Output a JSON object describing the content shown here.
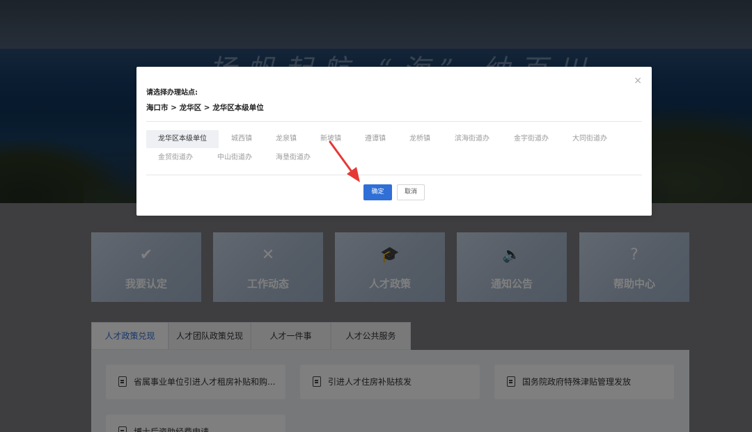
{
  "banner": {
    "slogan": "扬帆起航 “海” 纳百川"
  },
  "tiles": [
    {
      "label": "我要认定",
      "icon": "shield-check-icon",
      "glyph": "✔"
    },
    {
      "label": "工作动态",
      "icon": "pinwheel-icon",
      "glyph": "✕"
    },
    {
      "label": "人才政策",
      "icon": "graduation-cap-icon",
      "glyph": "🎓"
    },
    {
      "label": "通知公告",
      "icon": "speaker-icon",
      "glyph": "🔊"
    },
    {
      "label": "帮助中心",
      "icon": "help-icon",
      "glyph": "?"
    }
  ],
  "tabs": [
    {
      "label": "人才政策兑现",
      "active": true
    },
    {
      "label": "人才团队政策兑现"
    },
    {
      "label": "人才一件事"
    },
    {
      "label": "人才公共服务"
    }
  ],
  "cards": [
    {
      "text": "省属事业单位引进人才租房补贴和购...",
      "icon": "document-icon"
    },
    {
      "text": "引进人才住房补贴核发",
      "icon": "document-icon"
    },
    {
      "text": "国务院政府特殊津贴管理发放",
      "icon": "document-icon"
    },
    {
      "text": "博士后资助经费申请",
      "icon": "document-icon"
    }
  ],
  "modal": {
    "prompt": "请选择办理站点:",
    "path": "海口市 > 龙华区 > 龙华区本级单位",
    "close_glyph": "×",
    "stations": [
      {
        "label": "龙华区本级单位",
        "selected": true
      },
      {
        "label": "城西镇"
      },
      {
        "label": "龙泉镇"
      },
      {
        "label": "新坡镇"
      },
      {
        "label": "遵谭镇"
      },
      {
        "label": "龙桥镇"
      },
      {
        "label": "滨海街道办"
      },
      {
        "label": "金宇街道办"
      },
      {
        "label": "大同街道办"
      },
      {
        "label": "金贸街道办"
      },
      {
        "label": "中山街道办"
      },
      {
        "label": "海垦街道办"
      }
    ],
    "confirm_label": "确定",
    "cancel_label": "取消"
  },
  "colors": {
    "accent": "#2f6fd6",
    "annotation_arrow": "#e53935"
  }
}
